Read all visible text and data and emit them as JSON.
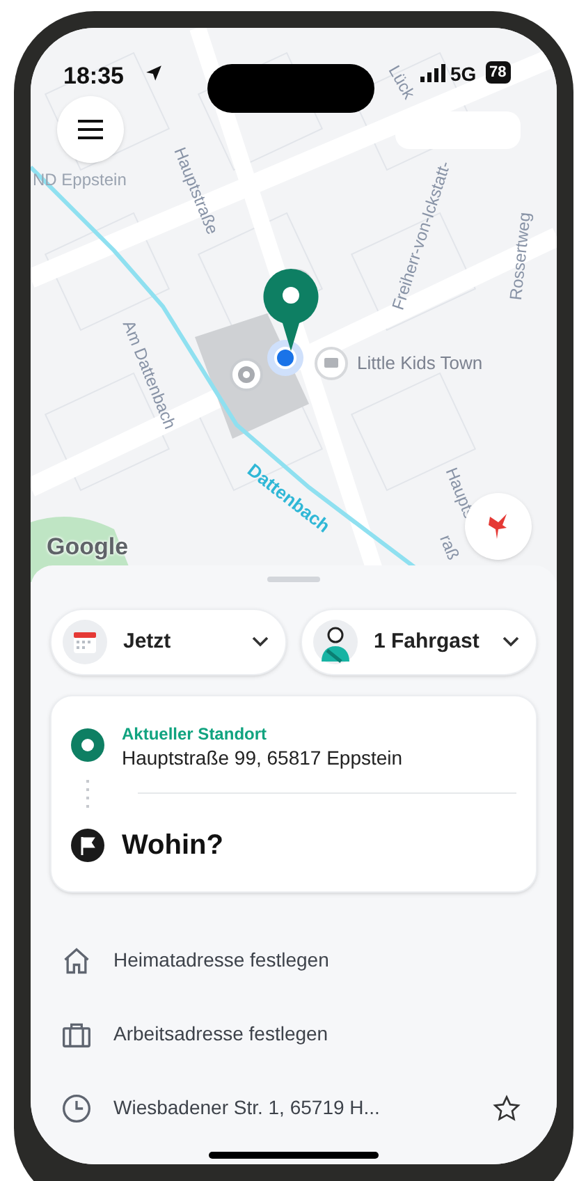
{
  "status_bar": {
    "time": "18:35",
    "network": "5G",
    "battery": "78"
  },
  "map": {
    "labels": [
      {
        "kind": "place",
        "text": "ND Eppstein"
      },
      {
        "kind": "street",
        "text": "Hauptstraße"
      },
      {
        "kind": "street",
        "text": "Lück"
      },
      {
        "kind": "street",
        "text": "Freiherr-von-Ickstatt-"
      },
      {
        "kind": "street",
        "text": "Rossertweg"
      },
      {
        "kind": "street",
        "text": "Am Dattenbach"
      },
      {
        "kind": "poi",
        "text": "Little Kids Town"
      },
      {
        "kind": "river",
        "text": "Dattenbach"
      },
      {
        "kind": "street",
        "text": "Haupts"
      },
      {
        "kind": "street",
        "text": "raß"
      }
    ],
    "attribution": "Google"
  },
  "sheet": {
    "pickers": [
      {
        "kind": "time",
        "label": "Jetzt"
      },
      {
        "kind": "passengers",
        "label": "1 Fahrgast"
      }
    ],
    "route": {
      "origin_caption": "Aktueller Standort",
      "origin_address": "Hauptstraße 99, 65817 Eppstein",
      "destination_placeholder": "Wohin?"
    },
    "shortcuts": [
      {
        "kind": "home",
        "label": "Heimatadresse festlegen"
      },
      {
        "kind": "work",
        "label": "Arbeitsadresse festlegen"
      },
      {
        "kind": "recent",
        "label": "Wiesbadener Str. 1, 65719 H...",
        "starred": false
      }
    ]
  }
}
